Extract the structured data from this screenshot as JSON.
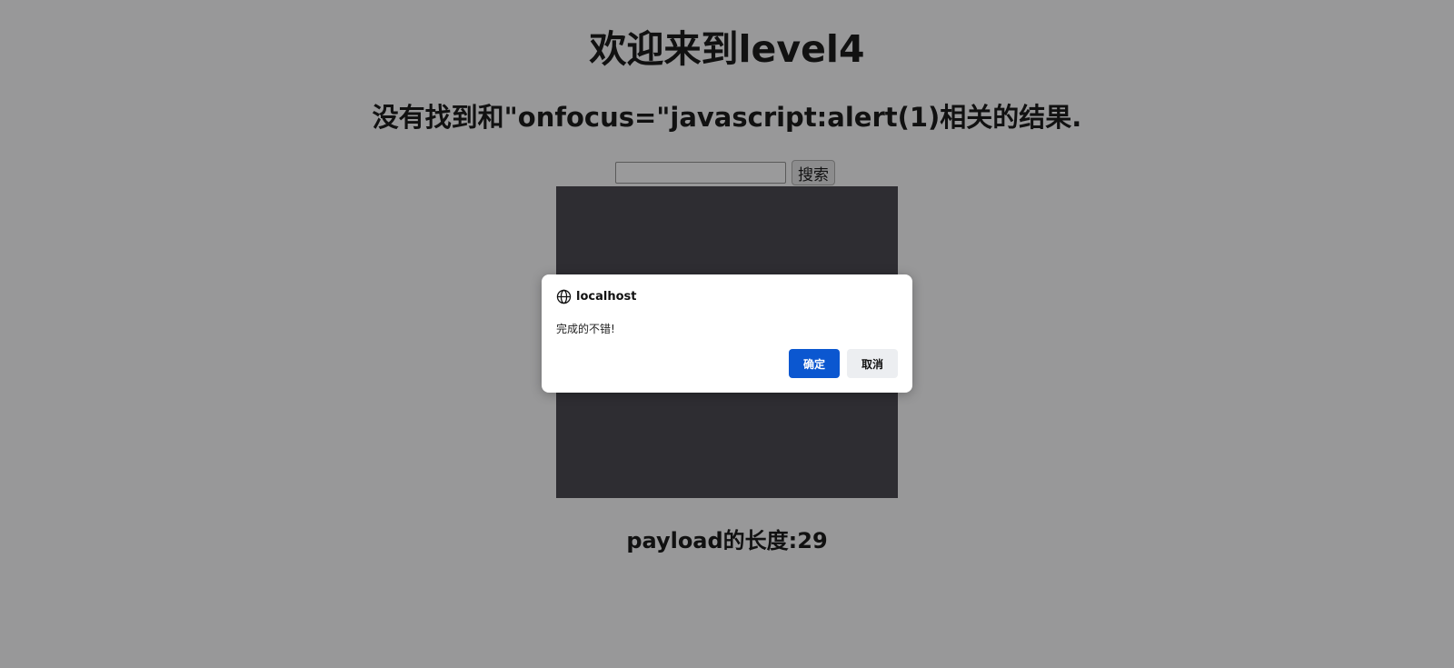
{
  "page": {
    "title": "欢迎来到level4",
    "result_heading": "没有找到和\"onfocus=\"javascript:alert(1)相关的结果.",
    "payload_length": "payload的长度:29"
  },
  "search": {
    "value": "",
    "placeholder": "",
    "button_label": "搜索"
  },
  "dialog": {
    "host": "localhost",
    "host_icon": "globe-icon",
    "message": "完成的不错!",
    "ok_label": "确定",
    "cancel_label": "取消"
  },
  "colors": {
    "background": "#989899",
    "panel": "#2e2d32",
    "dialog_ok": "#0b57d0",
    "dialog_cancel": "#eceef1"
  }
}
